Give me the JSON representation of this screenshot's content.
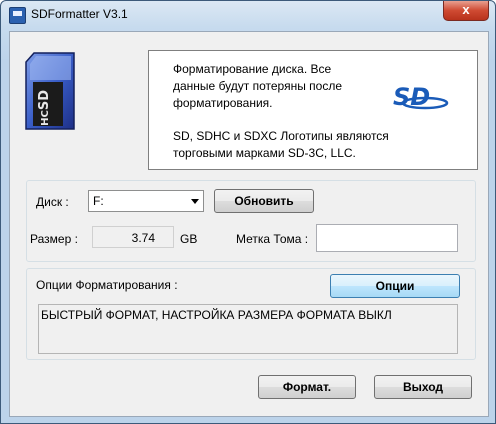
{
  "window": {
    "title": "SDFormatter V3.1",
    "close_glyph": "x"
  },
  "info": {
    "line1": "Форматирование диска. Все",
    "line2": "данные будут потеряны после",
    "line3": "форматирования.",
    "line4": "SD, SDHC и SDXC Логотипы являются",
    "line5": "торговыми марками SD-3C, LLC.",
    "logo_text": "SD"
  },
  "card_icon": "sd-hc-card-icon",
  "drive": {
    "label": "Диск :",
    "selected": "F:",
    "refresh_button": "Обновить",
    "size_label": "Размер :",
    "size_value": "3.74",
    "size_unit": "GB",
    "volume_label": "Метка Тома :",
    "volume_value": ""
  },
  "options": {
    "label": "Опции Форматирования :",
    "button": "Опции",
    "summary": "БЫСТРЫЙ ФОРМАТ, НАСТРОЙКА РАЗМЕРА ФОРМАТА ВЫКЛ"
  },
  "actions": {
    "format": "Формат.",
    "exit": "Выход"
  }
}
